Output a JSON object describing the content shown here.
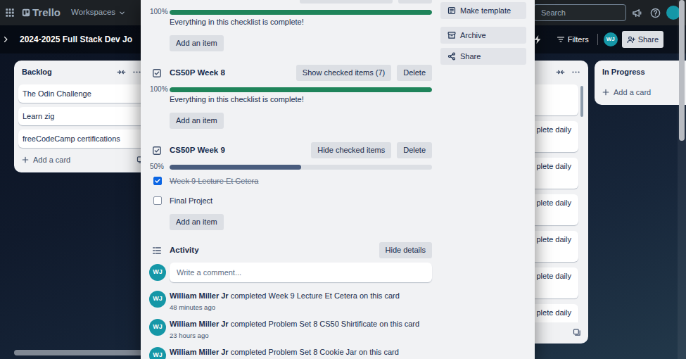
{
  "header": {
    "logo": "Trello",
    "workspaces": "Workspaces",
    "search": {
      "placeholder": "Search"
    }
  },
  "board": {
    "title": "2024-2025 Full Stack Dev Jo",
    "filters": "Filters",
    "avatar": "WJ",
    "share": "Share"
  },
  "lists": [
    {
      "kind": "full",
      "title": "Backlog",
      "cards": [
        {
          "kind": "text",
          "text": "The Odin Challenge"
        },
        {
          "kind": "text",
          "text": "Learn zig"
        },
        {
          "kind": "text",
          "text": "freeCodeCamp certifications"
        }
      ],
      "add": "Add a card"
    },
    {
      "kind": "clipped",
      "cards": [
        {
          "kind": "blank"
        },
        {
          "kind": "text",
          "text": "plete daily"
        },
        {
          "kind": "text",
          "text": "plete daily"
        },
        {
          "kind": "text",
          "text": "plete daily"
        },
        {
          "kind": "text",
          "text": "plete daily"
        },
        {
          "kind": "text",
          "text": "plete daily"
        },
        {
          "kind": "text",
          "text": "plete daily"
        }
      ]
    },
    {
      "kind": "full",
      "title": "In Progress",
      "cards": [],
      "add": "Add a card"
    }
  ],
  "card_modal": {
    "checklists": [
      {
        "kind": "clipped",
        "percent": "100%",
        "level": 1,
        "complete": true,
        "message": "Everything in this checklist is complete!",
        "add": "Add an item"
      },
      {
        "kind": "full",
        "title": "CS50P Week 8",
        "buttons": [
          "Show checked items (7)",
          "Delete"
        ],
        "percent": "100%",
        "level": 1,
        "complete": true,
        "message": "Everything in this checklist is complete!",
        "add": "Add an item"
      },
      {
        "kind": "full",
        "title": "CS50P Week 9",
        "buttons": [
          "Hide checked items",
          "Delete"
        ],
        "percent": "50%",
        "level": 0.5,
        "complete": false,
        "items": [
          {
            "text": "Week 9 Lecture Et Cetera",
            "checked": true
          },
          {
            "text": "Final Project",
            "checked": false
          }
        ],
        "add": "Add an item"
      }
    ],
    "activity": {
      "title": "Activity",
      "toggle": "Hide details",
      "comment": {
        "avatar": "WJ",
        "placeholder": "Write a comment..."
      },
      "entries": [
        {
          "avatar": "WJ",
          "user": "William Miller Jr",
          "action": "completed Week 9 Lecture Et Cetera on this card",
          "time": "48 minutes ago"
        },
        {
          "avatar": "WJ",
          "user": "William Miller Jr",
          "action": "completed Problem Set 8 CS50 Shirtificate on this card",
          "time": "23 hours ago"
        },
        {
          "avatar": "WJ",
          "user": "William Miller Jr",
          "action": "completed Problem Set 8 Cookie Jar on this card"
        }
      ]
    },
    "actions": [
      {
        "kind": "template",
        "label": "Make template"
      },
      {
        "kind": "archive",
        "label": "Archive"
      },
      {
        "kind": "share",
        "label": "Share"
      }
    ]
  }
}
